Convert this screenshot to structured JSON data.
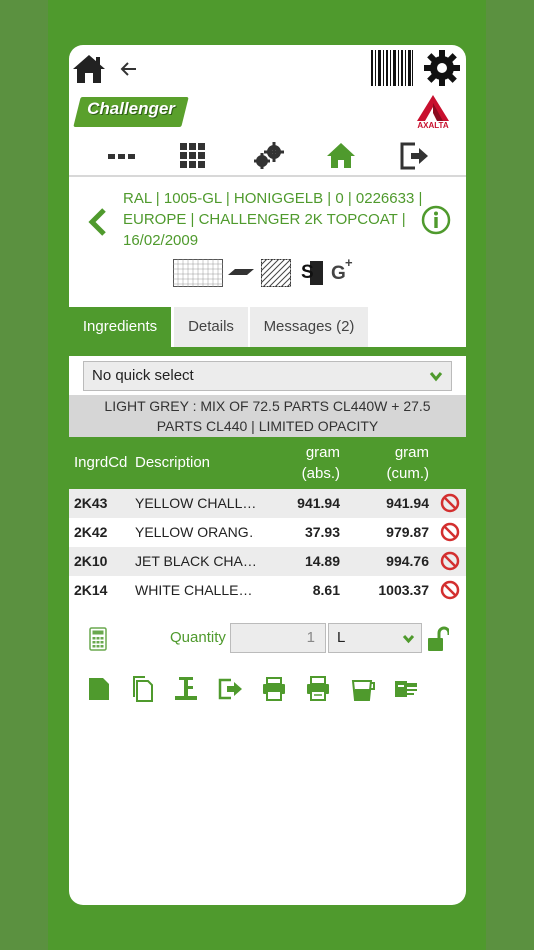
{
  "colors": {
    "accent": "#4f9a2d",
    "delete": "#d32f2f",
    "axalta_red": "#c8102e"
  },
  "topbar": {
    "icons": [
      "home-icon",
      "back-arrow-icon",
      "barcode-icon",
      "gear-icon"
    ]
  },
  "brand": {
    "logo_text": "Challenger",
    "axalta_text": "AXALTA"
  },
  "nav": {
    "icons": [
      "more-icon",
      "apps-grid-icon",
      "settings-gears-icon",
      "home-icon",
      "logout-icon"
    ]
  },
  "info": {
    "line1": "RAL | 1005-GL | HONIGGELB | 0 | 0226633 |",
    "line2": "EUROPE | CHALLENGER 2K TOPCOAT |",
    "line3": "16/02/2009",
    "swatch_s": "S",
    "swatch_g": "G",
    "swatch_g_sup": "+"
  },
  "tabs": [
    {
      "label": "Ingredients",
      "active": true
    },
    {
      "label": "Details",
      "active": false
    },
    {
      "label": "Messages (2)",
      "active": false
    }
  ],
  "quick_select": {
    "value": "No quick select"
  },
  "note": {
    "line1": "LIGHT GREY : MIX OF 72.5 PARTS CL440W + 27.5",
    "line2": "PARTS CL440 | LIMITED OPACITY"
  },
  "table": {
    "headers": {
      "code": "IngrdCd",
      "desc": "Description",
      "abs_1": "gram",
      "abs_2": "(abs.)",
      "cum_1": "gram",
      "cum_2": "(cum.)"
    },
    "rows": [
      {
        "code": "2K43",
        "desc": "YELLOW CHALL…",
        "abs": "941.94",
        "cum": "941.94"
      },
      {
        "code": "2K42",
        "desc": "YELLOW ORANG…",
        "abs": "37.93",
        "cum": "979.87"
      },
      {
        "code": "2K10",
        "desc": "JET BLACK CHA…",
        "abs": "14.89",
        "cum": "994.76"
      },
      {
        "code": "2K14",
        "desc": "WHITE CHALLE…",
        "abs": "8.61",
        "cum": "1003.37"
      }
    ]
  },
  "quantity": {
    "label": "Quantity",
    "value": "1",
    "unit": "L"
  },
  "actions": [
    "save-icon",
    "copy-icon",
    "scale-icon",
    "export-icon",
    "print-icon",
    "print-label-icon",
    "mixing-cup-icon",
    "dispense-icon"
  ]
}
